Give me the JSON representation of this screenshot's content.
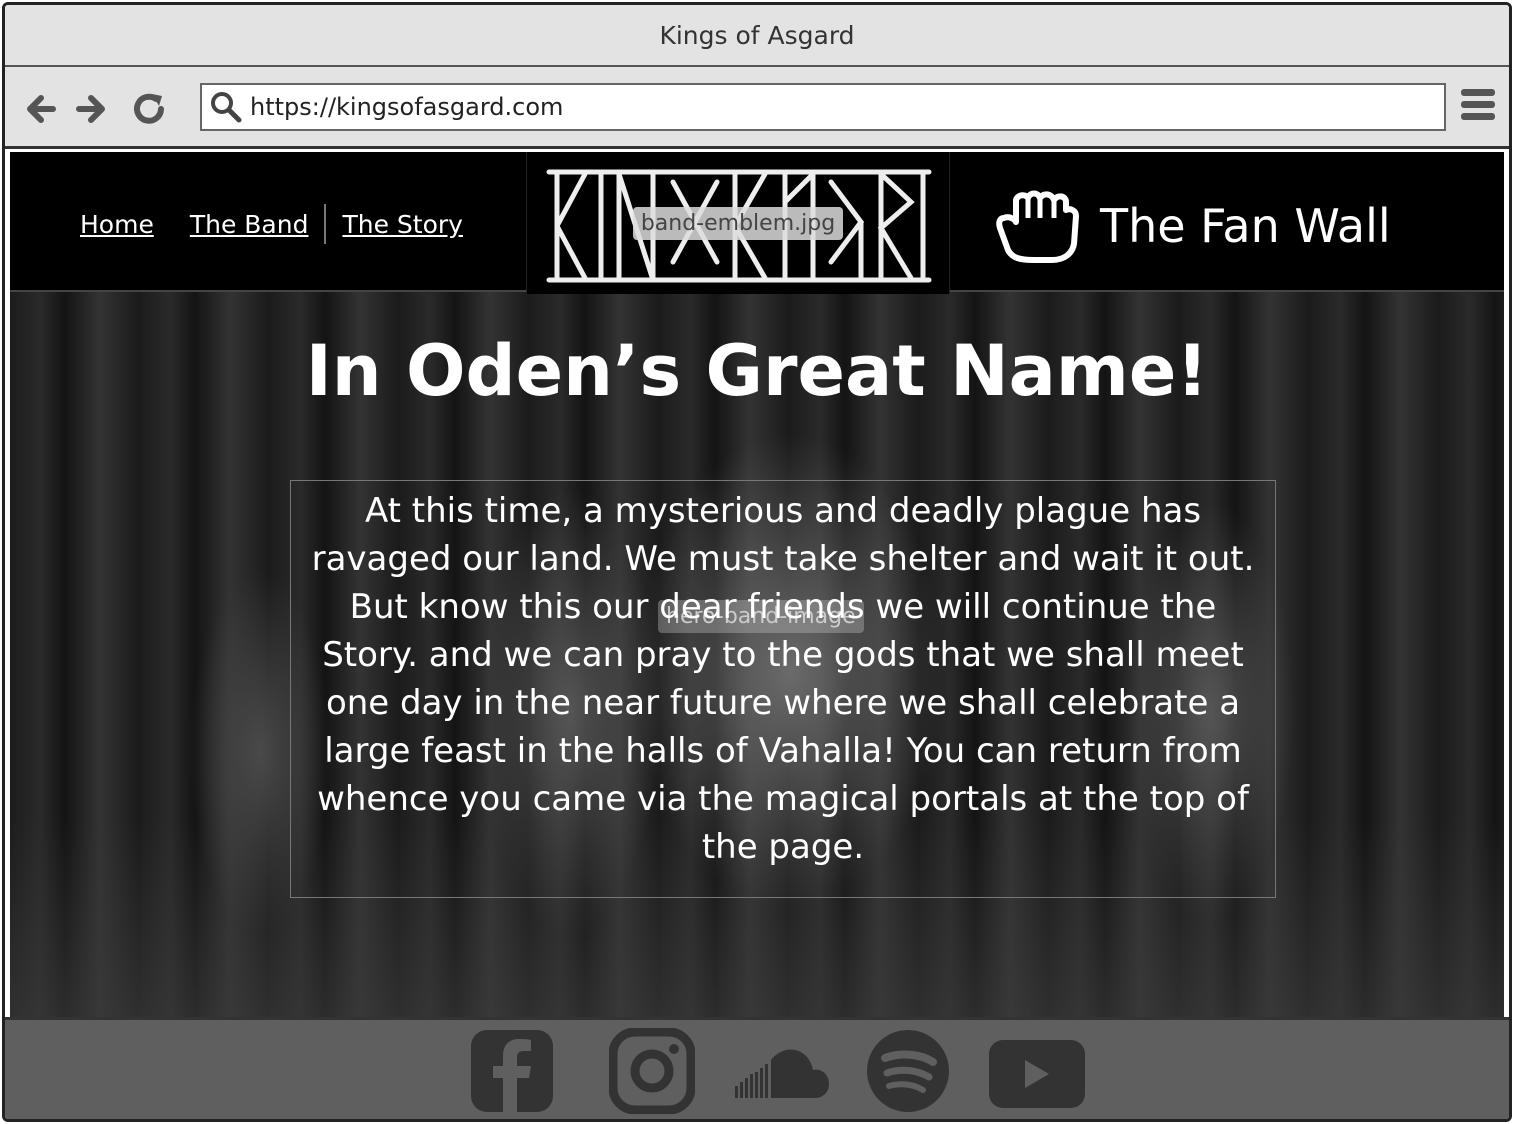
{
  "window": {
    "title": "Kings of Asgard"
  },
  "browser": {
    "url": "https://kingsofasgard.com",
    "back_icon": "arrow-left-icon",
    "forward_icon": "arrow-right-icon",
    "reload_icon": "reload-icon",
    "menu_icon": "hamburger-menu-icon"
  },
  "header": {
    "nav": [
      {
        "label": "Home"
      },
      {
        "label": "The Band"
      },
      {
        "label": "The Story"
      }
    ],
    "emblem_label": "band-emblem.jpg",
    "fan_wall_label": "The Fan Wall",
    "fan_wall_icon": "fist-icon"
  },
  "hero": {
    "image_label": "hero-band-image",
    "headline": "In Oden’s Great Name!",
    "message": "At this time, a mysterious and deadly plague has ravaged our land. We must take shelter and wait it out. But know this our dear friends we will continue the Story. and we can pray to the gods that we shall meet one day in the near future where we shall celebrate a large feast in the halls of Vahalla! You can return from whence you came via the magical portals at the top of the page."
  },
  "footer": {
    "social": [
      "facebook-icon",
      "instagram-icon",
      "soundcloud-icon",
      "spotify-icon",
      "youtube-icon"
    ]
  },
  "colors": {
    "chrome": "#e3e3e3",
    "header_bg": "#000000",
    "footer_bg": "#5f5f5f",
    "social_icon": "#333333",
    "text": "#ffffff"
  }
}
